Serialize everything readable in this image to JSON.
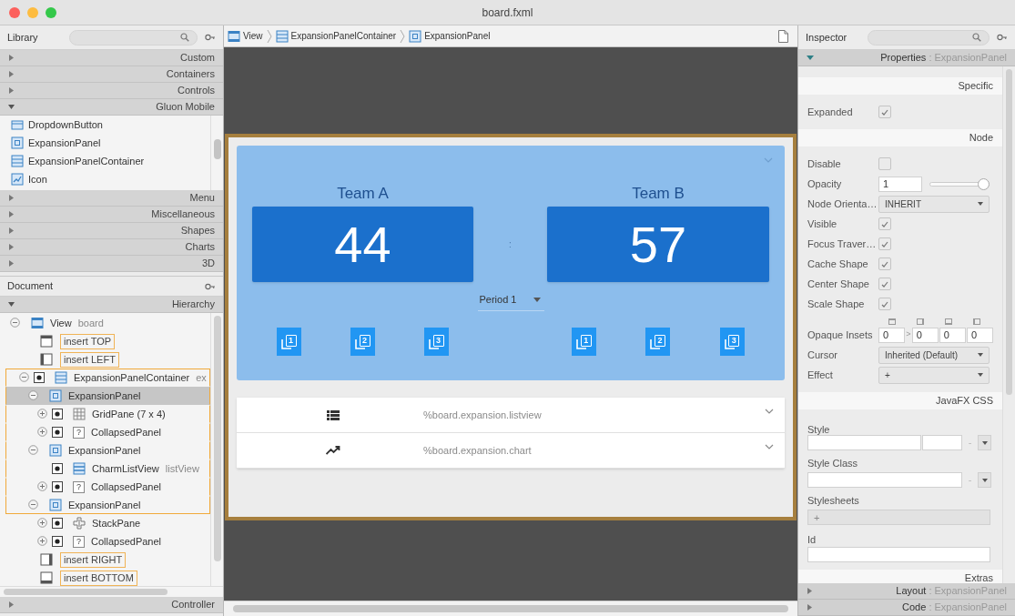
{
  "window": {
    "title": "board.fxml"
  },
  "library": {
    "title": "Library",
    "sections_top": [
      {
        "label": "Custom",
        "expanded": false
      },
      {
        "label": "Containers",
        "expanded": false
      },
      {
        "label": "Controls",
        "expanded": false
      },
      {
        "label": "Gluon Mobile",
        "expanded": true
      }
    ],
    "items": [
      {
        "kind": "dropdown",
        "label": "DropdownButton"
      },
      {
        "kind": "panel",
        "label": "ExpansionPanel"
      },
      {
        "kind": "container",
        "label": "ExpansionPanelContainer"
      },
      {
        "kind": "image",
        "label": "Icon"
      }
    ],
    "sections_bottom": [
      {
        "label": "Menu",
        "expanded": false
      },
      {
        "label": "Miscellaneous",
        "expanded": false
      },
      {
        "label": "Shapes",
        "expanded": false
      },
      {
        "label": "Charts",
        "expanded": false
      },
      {
        "label": "3D",
        "expanded": false
      }
    ]
  },
  "document": {
    "title": "Document",
    "section": {
      "label": "Hierarchy",
      "expanded": true
    },
    "tree": [
      {
        "kind": "view",
        "label": "View",
        "fx_id": "board",
        "expanded": true,
        "selected": false,
        "outlined": false,
        "visible_toggle": false,
        "children": [
          {
            "kind": "insert_top",
            "label": "insert TOP",
            "selected": false,
            "outlined": false,
            "visible_toggle": false
          },
          {
            "kind": "insert_left",
            "label": "insert LEFT",
            "selected": false,
            "outlined": false,
            "visible_toggle": false
          },
          {
            "kind": "container",
            "label": "ExpansionPanelContainer",
            "fx_id": "ex",
            "expanded": true,
            "selected": false,
            "outlined": true,
            "visible_toggle": true,
            "children": [
              {
                "kind": "panel",
                "label": "ExpansionPanel",
                "expanded": true,
                "selected": true,
                "outlined": true,
                "visible_toggle": false,
                "children": [
                  {
                    "kind": "grid",
                    "label": "GridPane (7 x 4)",
                    "expanded": false,
                    "selected": false,
                    "outlined": true,
                    "visible_toggle": true
                  },
                  {
                    "kind": "unknown",
                    "glyph": "?",
                    "label": "CollapsedPanel",
                    "expanded": false,
                    "selected": false,
                    "outlined": true,
                    "visible_toggle": true
                  }
                ]
              },
              {
                "kind": "panel",
                "label": "ExpansionPanel",
                "expanded": true,
                "selected": false,
                "outlined": true,
                "visible_toggle": false,
                "children": [
                  {
                    "kind": "list",
                    "label": "CharmListView",
                    "fx_id": "listView",
                    "selected": false,
                    "outlined": true,
                    "visible_toggle": true
                  },
                  {
                    "kind": "unknown",
                    "glyph": "?",
                    "label": "CollapsedPanel",
                    "expanded": false,
                    "selected": false,
                    "outlined": true,
                    "visible_toggle": true
                  }
                ]
              },
              {
                "kind": "panel",
                "label": "ExpansionPanel",
                "expanded": true,
                "selected": false,
                "outlined": true,
                "visible_toggle": false,
                "children": [
                  {
                    "kind": "stack",
                    "label": "StackPane",
                    "expanded": false,
                    "selected": false,
                    "outlined": false,
                    "visible_toggle": true
                  },
                  {
                    "kind": "unknown",
                    "glyph": "?",
                    "label": "CollapsedPanel",
                    "expanded": false,
                    "selected": false,
                    "outlined": false,
                    "visible_toggle": true
                  }
                ]
              }
            ]
          },
          {
            "kind": "insert_right",
            "label": "insert RIGHT",
            "selected": false,
            "outlined": false,
            "visible_toggle": false
          },
          {
            "kind": "insert_bottom",
            "label": "insert BOTTOM",
            "selected": false,
            "outlined": false,
            "visible_toggle": false
          }
        ]
      }
    ],
    "footer": {
      "label": "Controller",
      "expanded": false
    }
  },
  "breadcrumb": [
    {
      "kind": "view",
      "label": "View"
    },
    {
      "kind": "container",
      "label": "ExpansionPanelContainer"
    },
    {
      "kind": "panel",
      "label": "ExpansionPanel"
    }
  ],
  "canvas": {
    "teams": [
      {
        "name": "Team A",
        "score": "44"
      },
      {
        "name": "Team B",
        "score": "57"
      }
    ],
    "separator": ":",
    "period": "Period 1",
    "buttons": [
      [
        {
          "digit": "1"
        },
        {
          "digit": "2"
        },
        {
          "digit": "3"
        }
      ],
      [
        {
          "digit": "1"
        },
        {
          "digit": "2"
        },
        {
          "digit": "3"
        }
      ]
    ],
    "panels": [
      {
        "kind": "list",
        "label": "%board.expansion.listview",
        "expanded": false
      },
      {
        "kind": "trend",
        "label": "%board.expansion.chart",
        "expanded": false
      }
    ]
  },
  "inspector": {
    "title": "Inspector",
    "properties_bar": {
      "label": "Properties",
      "target": ": ExpansionPanel",
      "expanded": true
    },
    "sections": [
      {
        "title": "Specific",
        "rows": [
          {
            "kind": "checkbox",
            "label": "Expanded",
            "checked": true
          }
        ]
      },
      {
        "title": "Node",
        "rows": [
          {
            "kind": "checkbox",
            "label": "Disable",
            "checked": false
          },
          {
            "kind": "slider",
            "label": "Opacity",
            "value": "1",
            "level": 1
          },
          {
            "kind": "choice",
            "label": "Node Orienta…",
            "value": "INHERIT"
          },
          {
            "kind": "checkbox",
            "label": "Visible",
            "checked": true
          },
          {
            "kind": "checkbox",
            "label": "Focus Traver…",
            "checked": true
          },
          {
            "kind": "checkbox",
            "label": "Cache Shape",
            "checked": true
          },
          {
            "kind": "checkbox",
            "label": "Center Shape",
            "checked": true
          },
          {
            "kind": "checkbox",
            "label": "Scale Shape",
            "checked": true
          },
          {
            "kind": "insets",
            "label": "Opaque Insets",
            "link": ">",
            "values": [
              "0",
              "0",
              "0",
              "0"
            ]
          },
          {
            "kind": "choice",
            "label": "Cursor",
            "value": "Inherited (Default)"
          },
          {
            "kind": "choice",
            "label": "Effect",
            "value": "+"
          }
        ]
      },
      {
        "title": "JavaFX CSS",
        "rows": [
          {
            "kind": "style",
            "label": "Style",
            "reset": "-"
          },
          {
            "kind": "style_class",
            "label": "Style Class",
            "reset": "-"
          },
          {
            "kind": "list",
            "label": "Stylesheets",
            "button": "+"
          },
          {
            "kind": "text",
            "label": "Id"
          }
        ]
      },
      {
        "title": "Extras"
      }
    ],
    "footers": [
      {
        "label": "Layout",
        "target": ": ExpansionPanel",
        "expanded": false
      },
      {
        "label": "Code",
        "target": ": ExpansionPanel",
        "expanded": false
      }
    ]
  }
}
